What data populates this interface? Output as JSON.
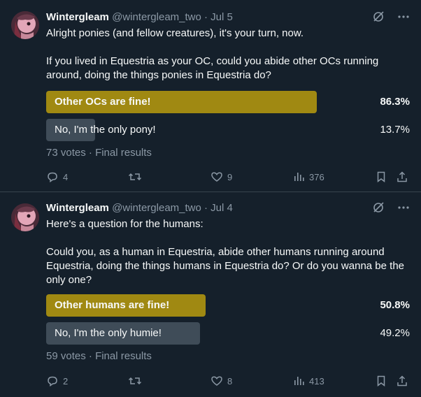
{
  "tweets": [
    {
      "author": "Wintergleam",
      "handle": "@wintergleam_two",
      "date": "· Jul 5",
      "text": [
        "Alright ponies (and fellow creatures), it's your turn, now.",
        "If you lived in Equestria as your OC, could you abide other OCs running around, doing the things ponies in Equestria do?"
      ],
      "poll": {
        "options": [
          {
            "label": "Other OCs are fine!",
            "percent_text": "86.3%",
            "percent": 86.3,
            "winner": true
          },
          {
            "label": "No, I'm the only pony!",
            "percent_text": "13.7%",
            "percent": 13.7,
            "winner": false
          }
        ],
        "votes": "73 votes",
        "status": "Final results"
      },
      "actions": {
        "replies": "4",
        "retweets": "",
        "likes": "9",
        "views": "376"
      }
    },
    {
      "author": "Wintergleam",
      "handle": "@wintergleam_two",
      "date": "· Jul 4",
      "text": [
        "Here's a question for the humans:",
        "Could you, as a human in Equestria, abide other humans running around Equestria, doing the things humans in Equestria do? Or do you wanna be the only one?"
      ],
      "poll": {
        "options": [
          {
            "label": "Other humans are fine!",
            "percent_text": "50.8%",
            "percent": 50.8,
            "winner": true
          },
          {
            "label": "No, I'm the only humie!",
            "percent_text": "49.2%",
            "percent": 49.2,
            "winner": false
          }
        ],
        "votes": "59 votes",
        "status": "Final results"
      },
      "actions": {
        "replies": "2",
        "retweets": "",
        "likes": "8",
        "views": "413"
      }
    }
  ],
  "icons": {
    "header": [
      "grok-slash-icon",
      "more-icon"
    ],
    "actions": [
      "reply-icon",
      "retweet-icon",
      "like-icon",
      "views-icon",
      "bookmark-icon",
      "share-icon"
    ]
  },
  "colors": {
    "background": "#15202b",
    "winner_bar": "#a08912",
    "loser_bar": "#3f4c58",
    "muted_text": "#8b98a5",
    "divider": "#38444d"
  }
}
